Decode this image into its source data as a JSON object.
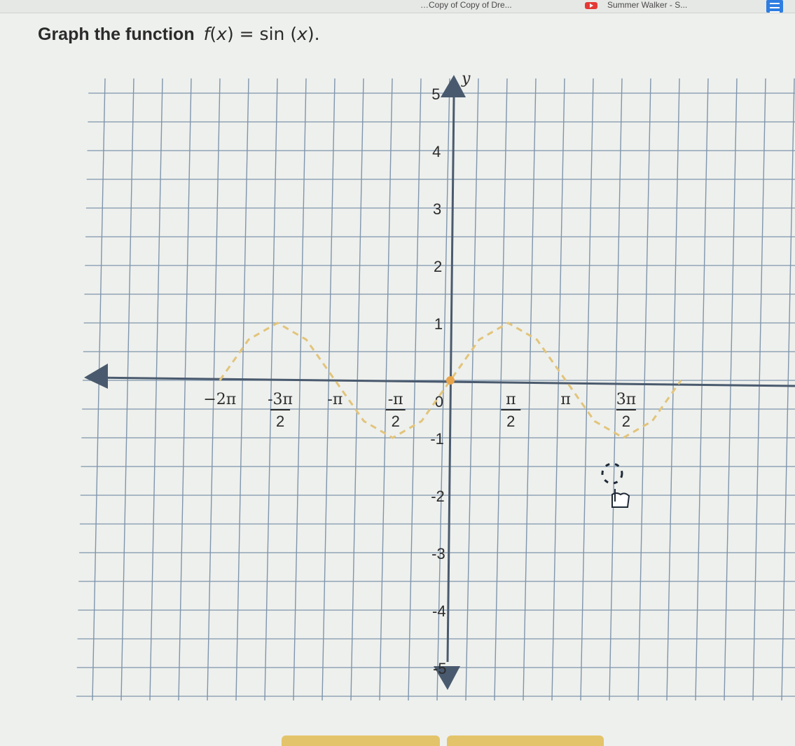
{
  "browser": {
    "tabs": [
      {
        "label": "…Copy of Copy of Dre..."
      },
      {
        "label": "Summer Walker - S..."
      }
    ],
    "accent": "#2f7de1",
    "yt_color": "#e53935"
  },
  "question": {
    "prefix": "Graph the function",
    "func_name": "f",
    "func_arg": "x",
    "equals": "=",
    "rhs": "sin",
    "rhs_arg": "x",
    "suffix": "."
  },
  "chart_data": {
    "type": "line",
    "title": "",
    "xlabel": "",
    "ylabel": "y",
    "grid": true,
    "xlim": [
      -6.6,
      6.6
    ],
    "ylim": [
      -5.2,
      5.2
    ],
    "y_ticks": [
      {
        "value": 5,
        "label": "5"
      },
      {
        "value": 4,
        "label": "4"
      },
      {
        "value": 3,
        "label": "3"
      },
      {
        "value": 2,
        "label": "2"
      },
      {
        "value": 1,
        "label": "1"
      },
      {
        "value": 0,
        "label": "0"
      },
      {
        "value": -1,
        "label": "-1"
      },
      {
        "value": -2,
        "label": "-2"
      },
      {
        "value": -3,
        "label": "-3"
      },
      {
        "value": -4,
        "label": "-4"
      },
      {
        "value": -5,
        "label": "-5"
      }
    ],
    "x_ticks": [
      {
        "value": -6.2832,
        "label": "−2π"
      },
      {
        "value": -4.7124,
        "label": "-3π/2",
        "num": "-3π",
        "den": "2"
      },
      {
        "value": -3.1416,
        "label": "-π"
      },
      {
        "value": -1.5708,
        "label": "-π/2",
        "num": "-π",
        "den": "2"
      },
      {
        "value": 1.5708,
        "label": "π/2",
        "num": "π",
        "den": "2"
      },
      {
        "value": 3.1416,
        "label": "π"
      },
      {
        "value": 4.7124,
        "label": "3π/2",
        "num": "3π",
        "den": "2"
      }
    ],
    "series": [
      {
        "style": "dashed",
        "color": "#e2c47a",
        "points": [
          [
            -6.2832,
            0
          ],
          [
            -5.4978,
            0.71
          ],
          [
            -4.7124,
            1
          ],
          [
            -3.927,
            0.71
          ],
          [
            -3.1416,
            0
          ],
          [
            -2.3562,
            -0.71
          ],
          [
            -1.5708,
            -1
          ],
          [
            -0.7854,
            -0.71
          ],
          [
            0,
            0
          ],
          [
            0.7854,
            0.71
          ],
          [
            1.5708,
            1
          ],
          [
            2.3562,
            0.71
          ],
          [
            3.1416,
            0
          ],
          [
            3.927,
            -0.71
          ],
          [
            4.7124,
            -1
          ],
          [
            5.4978,
            -0.71
          ],
          [
            6.2832,
            0
          ]
        ]
      }
    ],
    "plotted_points": [
      {
        "x": 0,
        "y": 0,
        "color": "#e8a44a"
      }
    ]
  }
}
